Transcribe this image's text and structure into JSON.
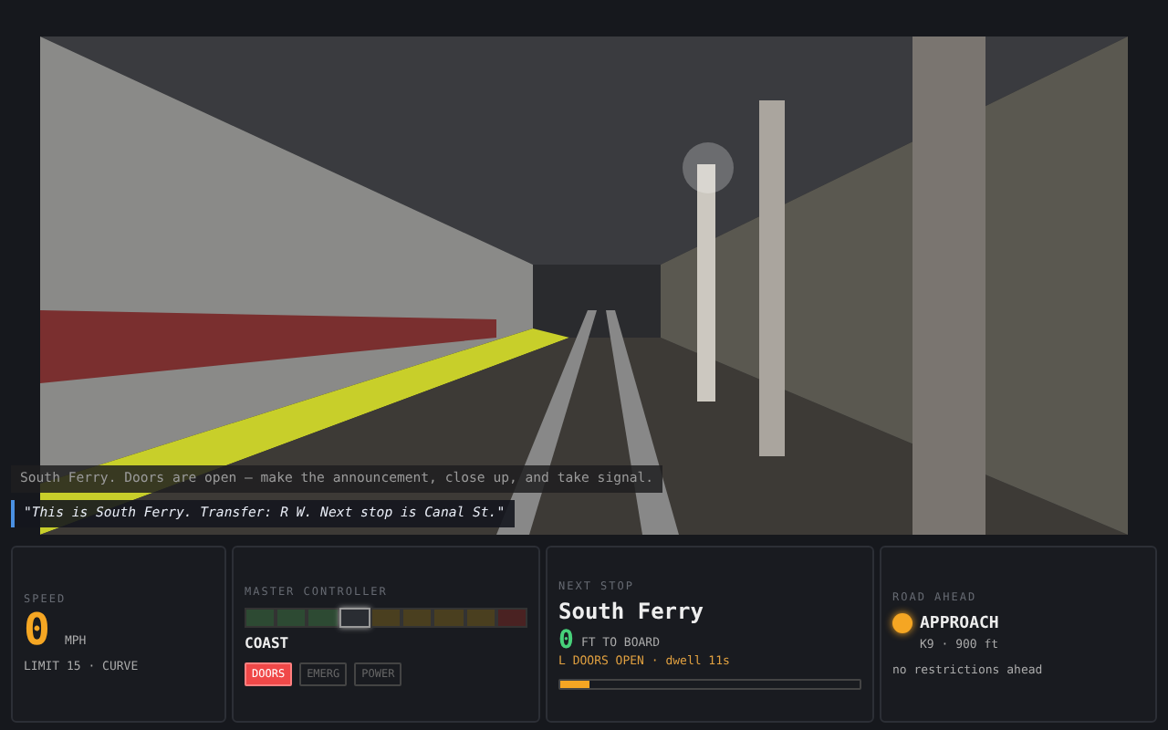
{
  "scene": {
    "messages": [
      {
        "kind": "dispatch",
        "text": "South Ferry. Doors are open — make the announcement, close up, and take signal."
      },
      {
        "kind": "announcement",
        "text": "\"This is South Ferry. Transfer: R W. Next stop is Canal St.\""
      }
    ]
  },
  "speed": {
    "label": "SPEED",
    "value": "0",
    "unit": "MPH",
    "limit": "LIMIT 15 · CURVE"
  },
  "master_controller": {
    "label": "MASTER CONTROLLER",
    "notches": [
      {
        "color": "#2d4a33",
        "selected": false
      },
      {
        "color": "#2d4a33",
        "selected": false
      },
      {
        "color": "#2d4a33",
        "selected": false
      },
      {
        "color": "#2a2d33",
        "selected": true
      },
      {
        "color": "#4a3f1f",
        "selected": false
      },
      {
        "color": "#4a3f1f",
        "selected": false
      },
      {
        "color": "#4a3f1f",
        "selected": false
      },
      {
        "color": "#4a3f1f",
        "selected": false
      },
      {
        "color": "#4a2222",
        "selected": false
      }
    ],
    "position": "COAST",
    "buttons": [
      {
        "label": "DOORS",
        "on": true
      },
      {
        "label": "EMERG",
        "on": false
      },
      {
        "label": "POWER",
        "on": false
      }
    ]
  },
  "next_stop": {
    "label": "NEXT STOP",
    "name": "South Ferry",
    "distance": "0",
    "distance_unit": "FT TO BOARD",
    "doors": "L DOORS OPEN · dwell 11s",
    "level": 0.1
  },
  "road_ahead": {
    "label": "ROAD AHEAD",
    "aspect": "APPROACH",
    "color": "#f5a623",
    "detail": "K9 · 900 ft",
    "note": "no restrictions ahead"
  }
}
